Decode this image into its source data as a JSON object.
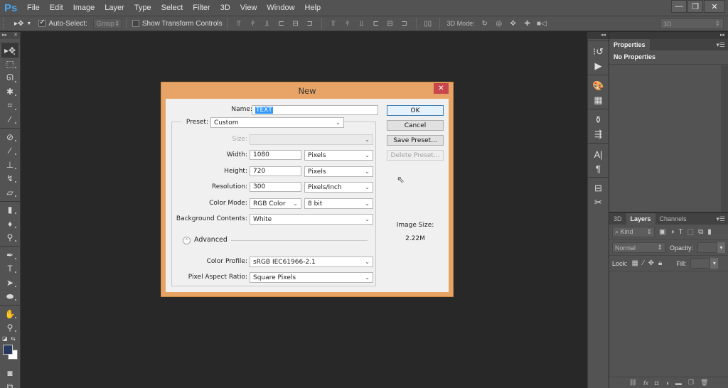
{
  "app": {
    "logo": "Ps",
    "menu": [
      "File",
      "Edit",
      "Image",
      "Layer",
      "Type",
      "Select",
      "Filter",
      "3D",
      "View",
      "Window",
      "Help"
    ],
    "window_controls": {
      "minimize": "—",
      "restore": "❐",
      "close": "✕"
    }
  },
  "options_bar": {
    "move_tool_icon": "move-tool-icon",
    "auto_select_label": "Auto-Select:",
    "auto_select_checked": true,
    "auto_select_target": "Group",
    "show_transform_label": "Show Transform Controls",
    "show_transform_checked": false,
    "mode_3d_label": "3D Mode:",
    "workspace": "3D"
  },
  "toolbar": {
    "tools": [
      {
        "name": "move-tool",
        "glyph": "▸✥"
      },
      {
        "name": "marquee-tool",
        "glyph": "⬚"
      },
      {
        "name": "lasso-tool",
        "glyph": "ᘏ"
      },
      {
        "name": "magic-wand-tool",
        "glyph": "✱"
      },
      {
        "name": "crop-tool",
        "glyph": "⌗"
      },
      {
        "name": "eyedropper-tool",
        "glyph": "⁄"
      },
      {
        "name": "healing-brush-tool",
        "glyph": "⊘"
      },
      {
        "name": "brush-tool",
        "glyph": "∕"
      },
      {
        "name": "clone-stamp-tool",
        "glyph": "⊥"
      },
      {
        "name": "history-brush-tool",
        "glyph": "↯"
      },
      {
        "name": "eraser-tool",
        "glyph": "▱"
      },
      {
        "name": "gradient-tool",
        "glyph": "▮"
      },
      {
        "name": "blur-tool",
        "glyph": "♦"
      },
      {
        "name": "dodge-tool",
        "glyph": "⚲"
      },
      {
        "name": "pen-tool",
        "glyph": "✒"
      },
      {
        "name": "type-tool",
        "glyph": "T"
      },
      {
        "name": "path-selection-tool",
        "glyph": "➤"
      },
      {
        "name": "ellipse-tool",
        "glyph": "⬬"
      },
      {
        "name": "hand-tool",
        "glyph": "✋"
      },
      {
        "name": "zoom-tool",
        "glyph": "⚲"
      }
    ],
    "foreground_color": "#283a5c",
    "background_color": "#ffffff"
  },
  "right_dock": {
    "icons": [
      "history-icon",
      "actions-play-icon",
      "swatches-palette-icon",
      "grid-icon",
      "brushes-icon",
      "brush-presets-icon",
      "character-icon",
      "paragraph-icon",
      "clone-source-icon",
      "tools-icon"
    ],
    "glyphs": [
      "⁝↺",
      "▶",
      "🎨",
      "▦",
      "⚱",
      "⇶",
      "A|",
      "¶",
      "⊟",
      "✂"
    ]
  },
  "properties_panel": {
    "tab": "Properties",
    "content": "No Properties"
  },
  "layers_panel": {
    "tabs": [
      "3D",
      "Layers",
      "Channels"
    ],
    "active_tab": "Layers",
    "filter_kind": "Kind",
    "blend_mode": "Normal",
    "opacity_label": "Opacity:",
    "lock_label": "Lock:",
    "fill_label": "Fill:"
  },
  "dialog": {
    "title": "New",
    "close": "✕",
    "name_label": "Name:",
    "name_value": "TEXT",
    "preset_label": "Preset:",
    "preset_value": "Custom",
    "size_label": "Size:",
    "size_value": "",
    "width_label": "Width:",
    "width_value": "1080",
    "width_unit": "Pixels",
    "height_label": "Height:",
    "height_value": "720",
    "height_unit": "Pixels",
    "resolution_label": "Resolution:",
    "resolution_value": "300",
    "resolution_unit": "Pixels/Inch",
    "color_mode_label": "Color Mode:",
    "color_mode_value": "RGB Color",
    "bit_depth": "8 bit",
    "background_label": "Background Contents:",
    "background_value": "White",
    "advanced_label": "Advanced",
    "color_profile_label": "Color Profile:",
    "color_profile_value": "sRGB IEC61966-2.1",
    "pixel_aspect_label": "Pixel Aspect Ratio:",
    "pixel_aspect_value": "Square Pixels",
    "buttons": {
      "ok": "OK",
      "cancel": "Cancel",
      "save_preset": "Save Preset...",
      "delete_preset": "Delete Preset..."
    },
    "image_size_label": "Image Size:",
    "image_size_value": "2.22M"
  }
}
